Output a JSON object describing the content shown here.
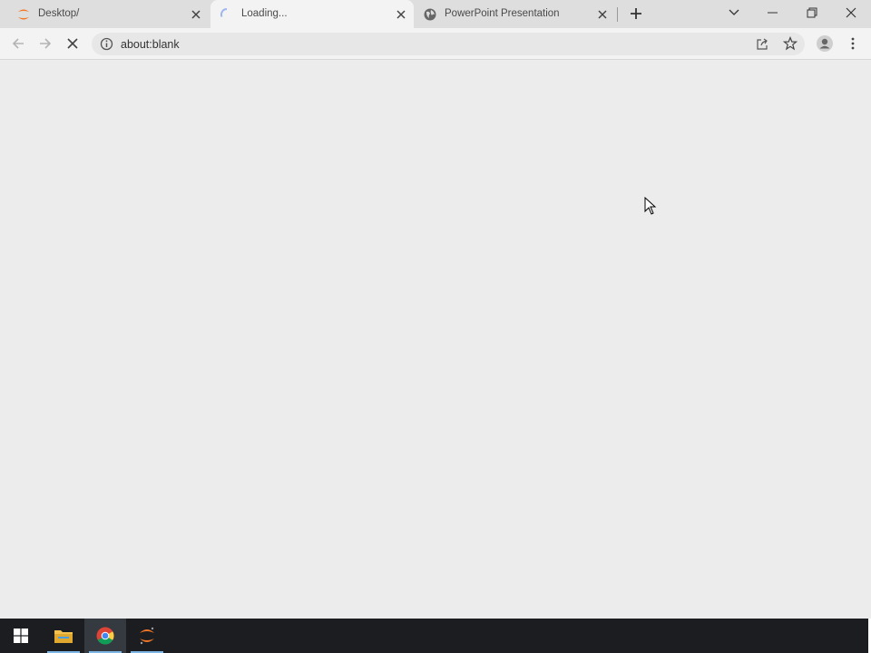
{
  "tabs": [
    {
      "label": "Desktop/",
      "icon": "jupyter-icon",
      "active": false
    },
    {
      "label": "Loading...",
      "icon": "loading-spinner-icon",
      "active": true
    },
    {
      "label": "PowerPoint Presentation",
      "icon": "globe-icon",
      "active": false
    }
  ],
  "address_bar": {
    "url": "about:blank"
  },
  "colors": {
    "tabstrip": "#dedede",
    "active_tab": "#f3f3f3",
    "content": "#ececec",
    "taskbar": "#1b1d21",
    "jupyter_orange": "#f37726"
  }
}
